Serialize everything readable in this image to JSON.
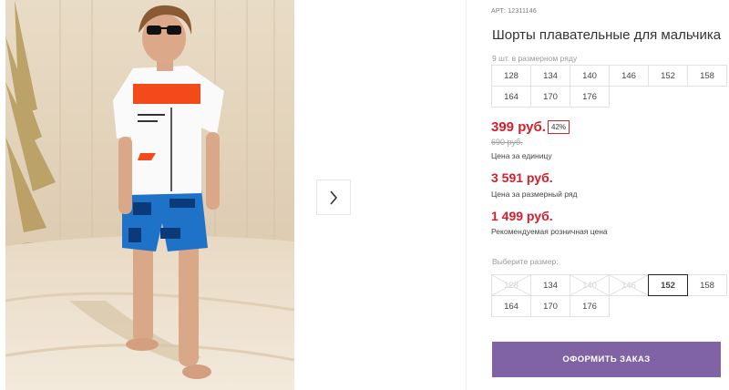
{
  "gallery": {
    "photo_alt": "Мальчик в футболке и синих шортах на песке",
    "next_icon": "chevron-right-icon"
  },
  "product": {
    "art_label": "АРТ:",
    "art_value": "12311146",
    "title": "Шорты плавательные для мальчика",
    "range_note": "9 шт. в размерном ряду",
    "range_sizes": [
      "128",
      "134",
      "140",
      "146",
      "152",
      "158",
      "164",
      "170",
      "176"
    ],
    "price": "399 руб.",
    "discount": "42%",
    "old_price": "690 руб.",
    "unit_label": "Цена за единицу",
    "range_price": "3 591 руб.",
    "range_price_label": "Цена за размерный ряд",
    "retail_price": "1 499 руб.",
    "retail_price_label": "Рекомендуемая розничная цена",
    "choose_size_label": "Выберите размер:",
    "select_sizes": [
      {
        "label": "128",
        "state": "disabled"
      },
      {
        "label": "134",
        "state": "available"
      },
      {
        "label": "140",
        "state": "disabled"
      },
      {
        "label": "146",
        "state": "disabled"
      },
      {
        "label": "152",
        "state": "selected"
      },
      {
        "label": "158",
        "state": "available"
      },
      {
        "label": "164",
        "state": "available"
      },
      {
        "label": "170",
        "state": "available"
      },
      {
        "label": "176",
        "state": "available"
      }
    ],
    "order_button": "ОФОРМИТЬ ЗАКАЗ"
  },
  "colors": {
    "price_red": "#d4202c",
    "button_purple": "#8063a5",
    "border_gray": "#e2e2e2"
  }
}
